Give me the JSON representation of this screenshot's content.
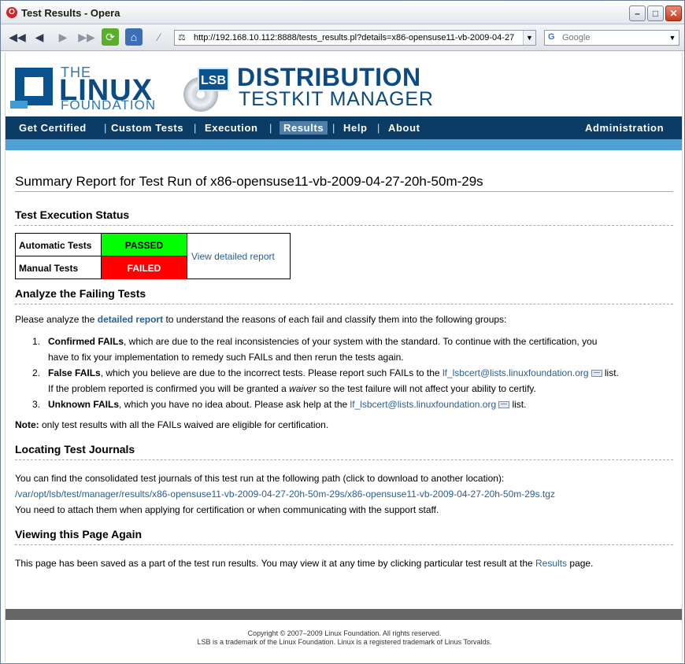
{
  "window": {
    "title": "Test Results - Opera",
    "opera_icon": "O"
  },
  "toolbar": {
    "url": "http://192.168.10.112:8888/tests_results.pl?details=x86-opensuse11-vb-2009-04-27",
    "search_placeholder": "Google",
    "search_engine_icon": "G"
  },
  "logo": {
    "lf_the": "THE",
    "lf_linux": "LINUX",
    "lf_foundation": "FOUNDATION",
    "lsb": "LSB",
    "dist_line1": "DISTRIBUTION",
    "dist_line2": "TESTKIT MANAGER"
  },
  "nav": {
    "items": [
      "Get Certified",
      "Custom Tests",
      "Execution",
      "Results",
      "Help",
      "About"
    ],
    "sep": "|",
    "admin": "Administration",
    "active": "Results"
  },
  "report": {
    "title": "Summary Report for Test Run of x86-opensuse11-vb-2009-04-27-20h-50m-29s",
    "exec_heading": "Test Execution Status",
    "automatic_label": "Automatic Tests",
    "automatic_status": "PASSED",
    "manual_label": "Manual Tests",
    "manual_status": "FAILED",
    "detailed_link": "View detailed report",
    "analyze_heading": "Analyze the Failing Tests",
    "analyze_intro_pre": "Please analyze the ",
    "analyze_intro_link": "detailed report",
    "analyze_intro_post": " to understand the reasons of each fail and classify them into the following groups:",
    "items": [
      {
        "num": "1.",
        "bold": "Confirmed FAILs",
        "line1": ", which are due to the real inconsistencies of your system with the standard. To continue with the certification, you",
        "line2": "have to fix your implementation to remedy such FAILs and then rerun the tests again."
      },
      {
        "num": "2.",
        "bold": "False FAILs",
        "line1": ", which you believe are due to the incorrect tests. Please report such FAILs to the ",
        "email": "lf_lsbcert@lists.linuxfoundation.org",
        "line1_end": " list.",
        "line2_pre": "If the problem reported is confirmed you will be granted a ",
        "line2_em": "waiver",
        "line2_post": " so the test failure will not affect your ability to certify."
      },
      {
        "num": "3.",
        "bold": "Unknown FAILs",
        "line1": ", which you have no idea about. Please ask help at the ",
        "email": "lf_lsbcert@lists.linuxfoundation.org",
        "line1_end": " list."
      }
    ],
    "note_label": "Note:",
    "note_text": " only test results with all the FAILs waived are eligible for certification.",
    "journals_heading": "Locating Test Journals",
    "journals_line1": "You can find the consolidated test journals of this test run at the following path (click to download to another location):",
    "journals_path": "/var/opt/lsb/test/manager/results/x86-opensuse11-vb-2009-04-27-20h-50m-29s/x86-opensuse11-vb-2009-04-27-20h-50m-29s.tgz",
    "journals_line3": "You need to attach them when applying for certification or when communicating with the support staff.",
    "viewing_heading": "Viewing this Page Again",
    "viewing_pre": "This page has been saved as a part of the test run results. You may view it at any time by clicking particular test result at the ",
    "viewing_link": "Results",
    "viewing_post": " page."
  },
  "footer": {
    "line1": "Copyright © 2007–2009 Linux Foundation. All rights reserved.",
    "line2": "LSB is a trademark of the Linux Foundation. Linux is a registered trademark of Linus Torvalds."
  },
  "colors": {
    "nav_bg": "#0a3c66",
    "subbar": "#4ea1d5",
    "passed": "#00ff00",
    "failed": "#ff0000",
    "link": "#2c5f8e"
  }
}
